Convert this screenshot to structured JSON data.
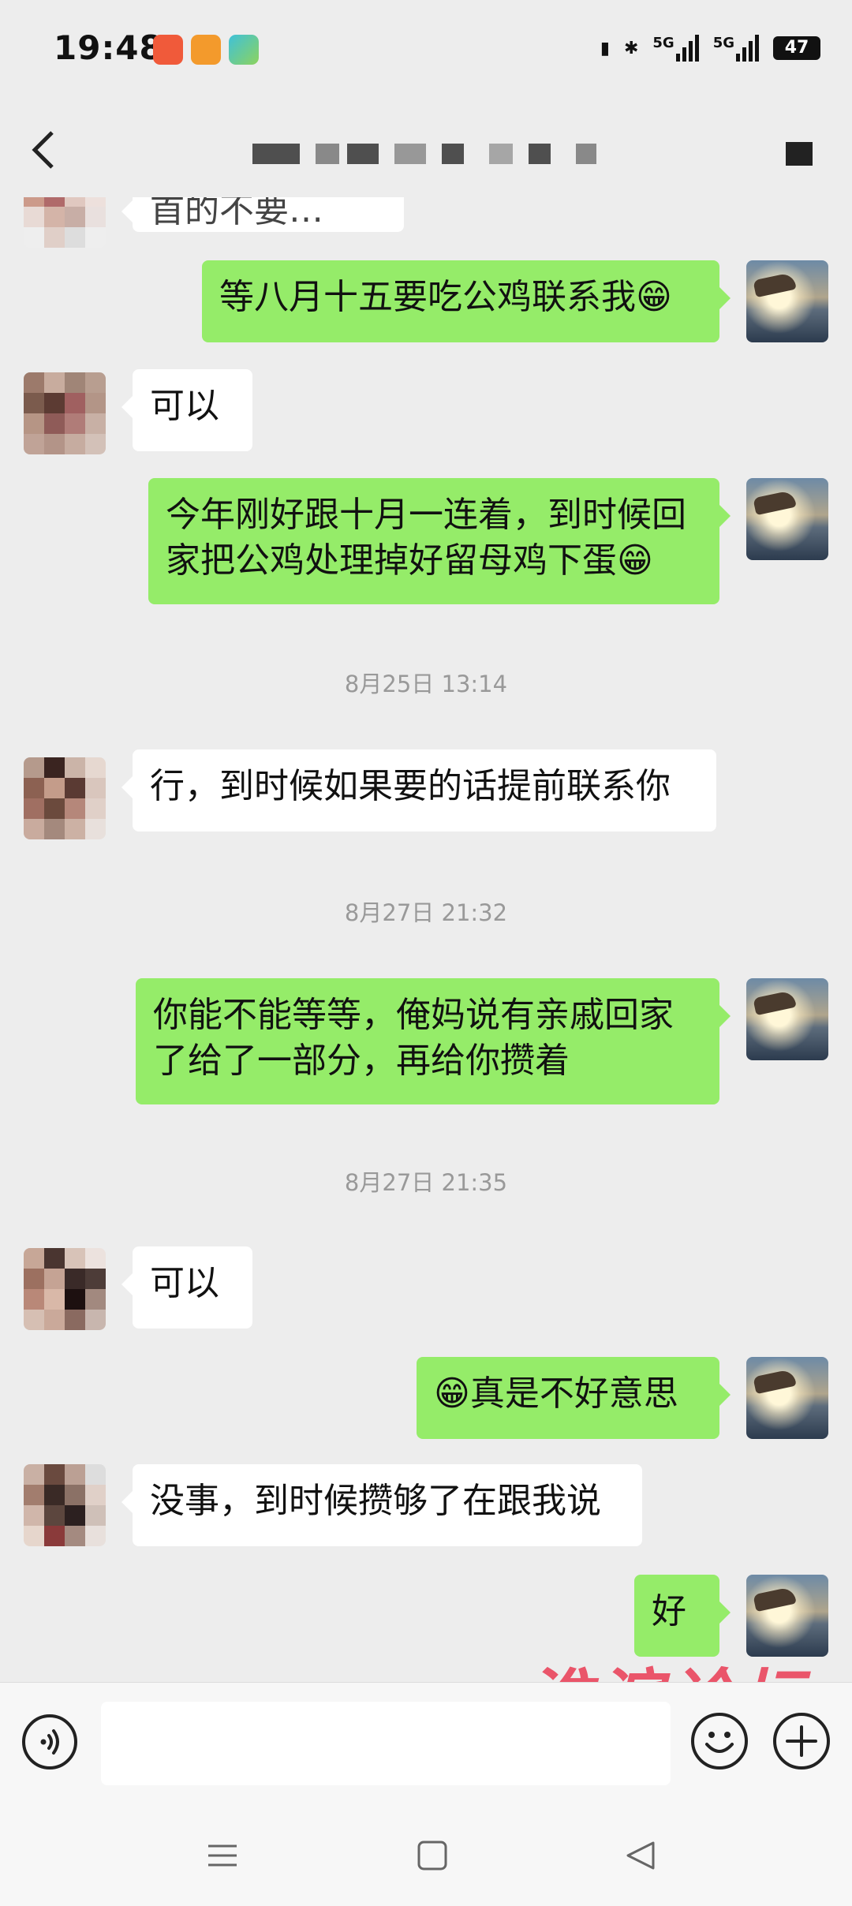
{
  "status_bar": {
    "time": "19:48",
    "battery": "47",
    "net1": "5G",
    "net2": "5G"
  },
  "messages": [
    {
      "side": "left",
      "text": "首的不要…",
      "partial": true
    },
    {
      "side": "right",
      "text": "等八月十五要吃公鸡联系我😁"
    },
    {
      "side": "left",
      "text": "可以"
    },
    {
      "side": "right",
      "text": "今年刚好跟十月一连着，到时候回家把公鸡处理掉好留母鸡下蛋😁"
    },
    {
      "type": "timestamp",
      "text": "8月25日 13:14"
    },
    {
      "side": "left",
      "text": "行，到时候如果要的话提前联系你"
    },
    {
      "type": "timestamp",
      "text": "8月27日 21:32"
    },
    {
      "side": "right",
      "text": "你能不能等等，俺妈说有亲戚回家了给了一部分，再给你攒着"
    },
    {
      "type": "timestamp",
      "text": "8月27日 21:35"
    },
    {
      "side": "left",
      "text": "可以"
    },
    {
      "side": "right",
      "text": "😁真是不好意思"
    },
    {
      "side": "left",
      "text": "没事，到时候攒够了在跟我说"
    },
    {
      "side": "right",
      "text": "好"
    }
  ],
  "watermark": "淮滨论坛",
  "colors": {
    "self_bubble": "#95ec69",
    "other_bubble": "#ffffff",
    "background": "#ededed",
    "watermark": "#ea3b54"
  },
  "icons": {
    "back": "chevron-left-icon",
    "voice": "voice-icon",
    "emoji": "smiley-icon",
    "plus": "plus-icon",
    "more": "more-icon"
  }
}
